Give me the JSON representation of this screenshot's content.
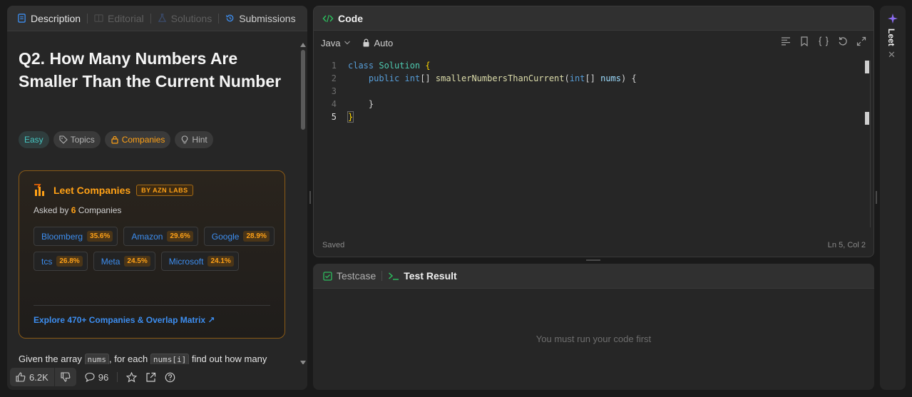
{
  "left_panel": {
    "tabs": [
      {
        "label": "Description",
        "active": true
      },
      {
        "label": "Editorial",
        "active": false
      },
      {
        "label": "Solutions",
        "active": false
      },
      {
        "label": "Submissions",
        "active": false
      }
    ],
    "title": "Q2. How Many Numbers Are Smaller Than the Current Number",
    "chips": {
      "difficulty": "Easy",
      "topics": "Topics",
      "companies": "Companies",
      "hint": "Hint"
    },
    "companies_card": {
      "title": "Leet Companies",
      "badge": "BY AZN LABS",
      "asked_prefix": "Asked by",
      "asked_count": "6",
      "asked_suffix": "Companies",
      "companies": [
        {
          "name": "Bloomberg",
          "pct": "35.6%"
        },
        {
          "name": "Amazon",
          "pct": "29.6%"
        },
        {
          "name": "Google",
          "pct": "28.9%"
        },
        {
          "name": "tcs",
          "pct": "26.8%"
        },
        {
          "name": "Meta",
          "pct": "24.5%"
        },
        {
          "name": "Microsoft",
          "pct": "24.1%"
        }
      ],
      "explore_link": "Explore 470+ Companies & Overlap Matrix ↗"
    },
    "description": {
      "part1": "Given the array",
      "code1": "nums",
      "part2": ", for each",
      "code2": "nums[i]",
      "part3": "find out how many"
    },
    "footer": {
      "likes": "6.2K",
      "comments": "96"
    }
  },
  "code_panel": {
    "header": "Code",
    "language": "Java",
    "mode": "Auto",
    "lines": [
      "1",
      "2",
      "3",
      "4",
      "5"
    ],
    "status_left": "Saved",
    "status_right": "Ln 5, Col 2"
  },
  "test_panel": {
    "tabs": [
      {
        "label": "Testcase",
        "active": false
      },
      {
        "label": "Test Result",
        "active": true
      }
    ],
    "message": "You must run your code first"
  },
  "right_strip": {
    "label": "Leet"
  },
  "colors": {
    "accent_orange": "#ffa116",
    "link_blue": "#3d8ef0",
    "easy_teal": "#46c6c2",
    "panel_bg": "#262626",
    "page_bg": "#1a1a1a"
  }
}
